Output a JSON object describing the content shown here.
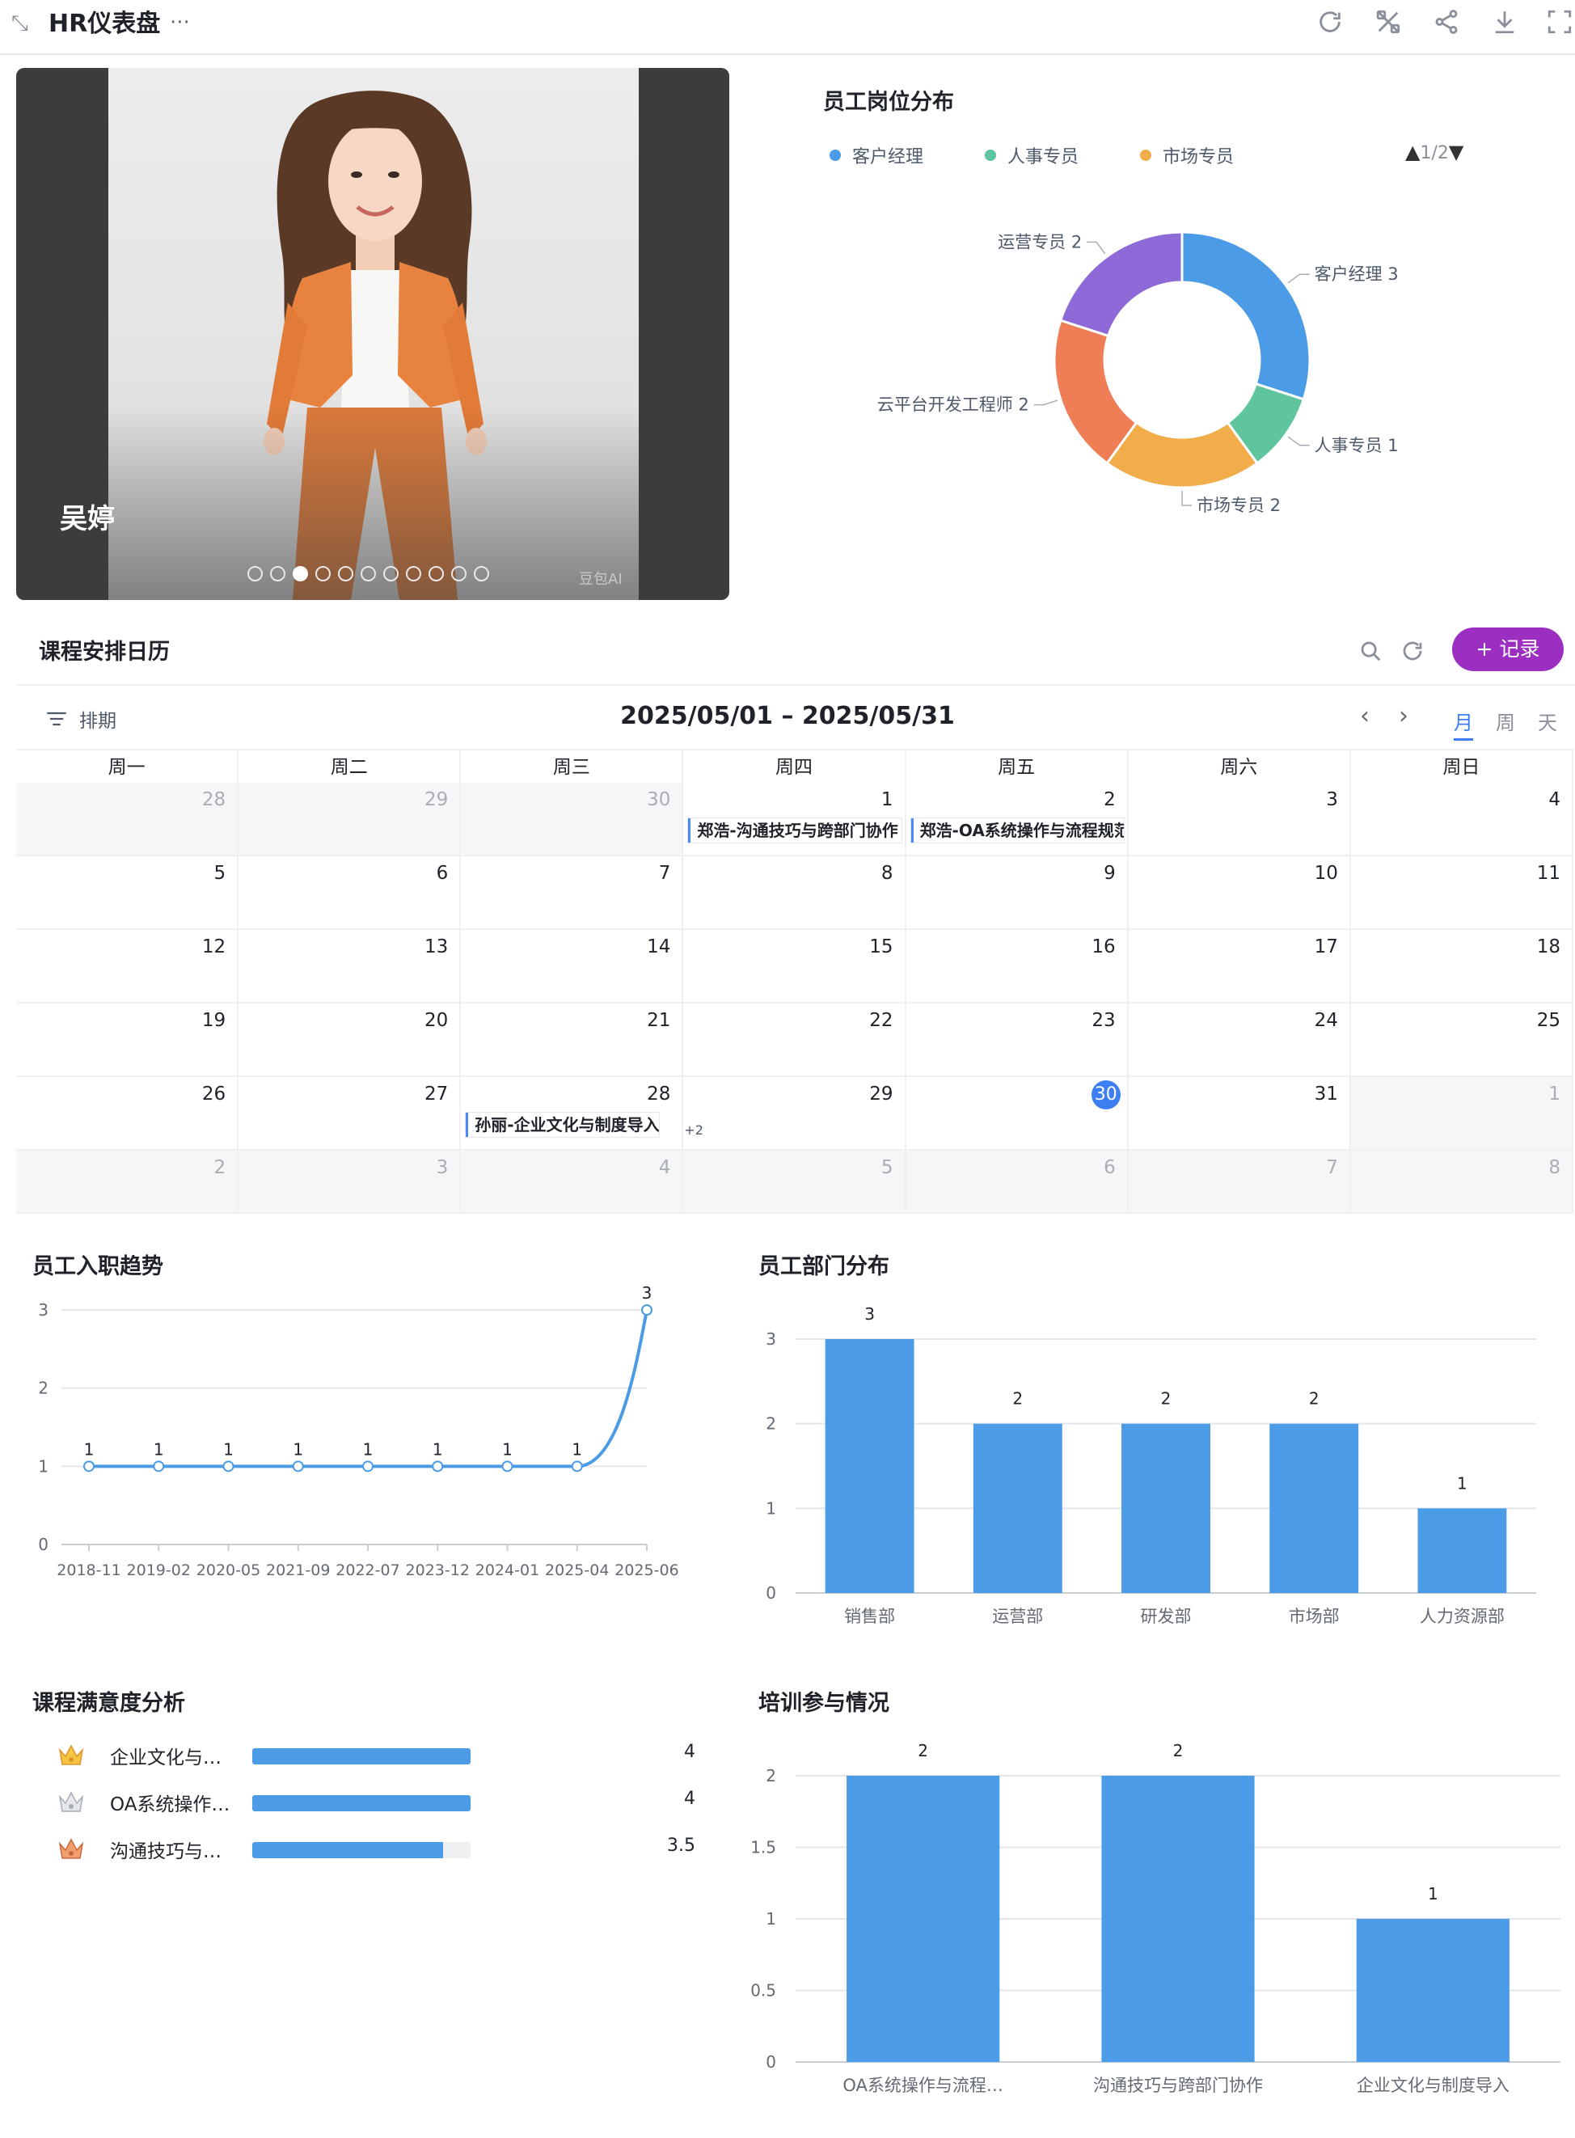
{
  "header": {
    "title": "HR仪表盘",
    "more": "···"
  },
  "carousel": {
    "caption": "吴婷",
    "watermark": "豆包AI",
    "dot_count": 11,
    "active_index": 2
  },
  "position_chart": {
    "title": "员工岗位分布",
    "legend": [
      {
        "label": "客户经理",
        "color": "#4b9be6"
      },
      {
        "label": "人事专员",
        "color": "#5ec59f"
      },
      {
        "label": "市场专员",
        "color": "#f0ad4a"
      }
    ],
    "pager": "1/2",
    "chart_data": {
      "type": "pie",
      "donut": true,
      "slices": [
        {
          "label": "客户经理",
          "value": 3,
          "color": "#4b9be6"
        },
        {
          "label": "人事专员",
          "value": 1,
          "color": "#5ec59f"
        },
        {
          "label": "市场专员",
          "value": 2,
          "color": "#f0ad4a"
        },
        {
          "label": "云平台开发工程师",
          "value": 2,
          "color": "#ef7d56"
        },
        {
          "label": "运营专员",
          "value": 2,
          "color": "#8e6ad8"
        }
      ]
    }
  },
  "calendar": {
    "title": "课程安排日历",
    "add_button": "+ 记录",
    "schedule_label": "排期",
    "range": "2025/05/01 – 2025/05/31",
    "views": [
      "月",
      "周",
      "天"
    ],
    "active_view": 0,
    "weekdays": [
      "周一",
      "周二",
      "周三",
      "周四",
      "周五",
      "周六",
      "周日"
    ],
    "weeks": [
      [
        {
          "d": "28",
          "out": true
        },
        {
          "d": "29",
          "out": true
        },
        {
          "d": "30",
          "out": true
        },
        {
          "d": "1",
          "event": "郑浩-沟通技巧与跨部门协作"
        },
        {
          "d": "2",
          "event": "郑浩-OA系统操作与流程规范"
        },
        {
          "d": "3"
        },
        {
          "d": "4"
        }
      ],
      [
        {
          "d": "5"
        },
        {
          "d": "6"
        },
        {
          "d": "7"
        },
        {
          "d": "8"
        },
        {
          "d": "9"
        },
        {
          "d": "10"
        },
        {
          "d": "11"
        }
      ],
      [
        {
          "d": "12"
        },
        {
          "d": "13"
        },
        {
          "d": "14"
        },
        {
          "d": "15"
        },
        {
          "d": "16"
        },
        {
          "d": "17"
        },
        {
          "d": "18"
        }
      ],
      [
        {
          "d": "19"
        },
        {
          "d": "20"
        },
        {
          "d": "21"
        },
        {
          "d": "22"
        },
        {
          "d": "23"
        },
        {
          "d": "24"
        },
        {
          "d": "25"
        }
      ],
      [
        {
          "d": "26"
        },
        {
          "d": "27"
        },
        {
          "d": "28",
          "event": "孙丽-企业文化与制度导入-",
          "more": "+2"
        },
        {
          "d": "29"
        },
        {
          "d": "30",
          "today": true
        },
        {
          "d": "31"
        },
        {
          "d": "1",
          "out": true
        }
      ],
      [
        {
          "d": "2",
          "out": true
        },
        {
          "d": "3",
          "out": true
        },
        {
          "d": "4",
          "out": true
        },
        {
          "d": "5",
          "out": true
        },
        {
          "d": "6",
          "out": true
        },
        {
          "d": "7",
          "out": true
        },
        {
          "d": "8",
          "out": true
        }
      ]
    ]
  },
  "onboarding_trend": {
    "title": "员工入职趋势",
    "chart_data": {
      "type": "line",
      "x": [
        "2018-11",
        "2019-02",
        "2020-05",
        "2021-09",
        "2022-07",
        "2023-12",
        "2024-01",
        "2025-04",
        "2025-06"
      ],
      "values": [
        1,
        1,
        1,
        1,
        1,
        1,
        1,
        1,
        3
      ],
      "ylim": [
        0,
        3
      ],
      "yticks": [
        0,
        1,
        2,
        3
      ],
      "color": "#4b9be6"
    }
  },
  "department_chart": {
    "title": "员工部门分布",
    "chart_data": {
      "type": "bar",
      "categories": [
        "销售部",
        "运营部",
        "研发部",
        "市场部",
        "人力资源部"
      ],
      "values": [
        3,
        2,
        2,
        2,
        1
      ],
      "ylim": [
        0,
        3
      ],
      "yticks": [
        0,
        1,
        2,
        3
      ],
      "color": "#4b9be6"
    }
  },
  "satisfaction": {
    "title": "课程满意度分析",
    "max": 4,
    "items": [
      {
        "label": "企业文化与…",
        "value": "4",
        "score": 4,
        "medal": "gold"
      },
      {
        "label": "OA系统操作…",
        "value": "4",
        "score": 4,
        "medal": "silver"
      },
      {
        "label": "沟通技巧与…",
        "value": "3.5",
        "score": 3.5,
        "medal": "bronze"
      }
    ]
  },
  "training_chart": {
    "title": "培训参与情况",
    "chart_data": {
      "type": "bar",
      "categories": [
        "OA系统操作与流程…",
        "沟通技巧与跨部门协作",
        "企业文化与制度导入"
      ],
      "values": [
        2,
        2,
        1
      ],
      "ylim": [
        0,
        2
      ],
      "yticks": [
        "0",
        "0.5",
        "1",
        "1.5",
        "2"
      ],
      "color": "#4b9be6"
    }
  }
}
